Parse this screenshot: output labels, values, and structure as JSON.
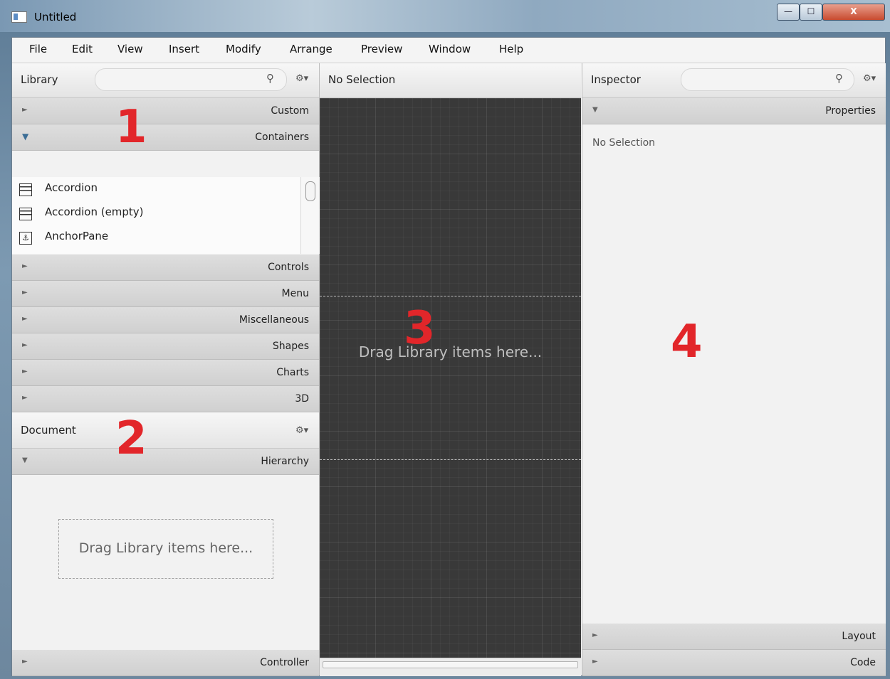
{
  "window": {
    "title": "Untitled",
    "minimize_glyph": "—",
    "maximize_glyph": "☐",
    "close_glyph": "X"
  },
  "menu": [
    "File",
    "Edit",
    "View",
    "Insert",
    "Modify",
    "Arrange",
    "Preview",
    "Window",
    "Help"
  ],
  "library": {
    "title": "Library",
    "search_icon": "⚲",
    "gear": "⚙▾",
    "sections": {
      "custom": "Custom",
      "containers": "Containers",
      "controls": "Controls",
      "menu": "Menu",
      "miscellaneous": "Miscellaneous",
      "shapes": "Shapes",
      "charts": "Charts",
      "three_d": "3D"
    },
    "items": [
      {
        "label": "Accordion",
        "icon": "accordion-icon"
      },
      {
        "label": "Accordion  (empty)",
        "icon": "accordion-icon"
      },
      {
        "label": "AnchorPane",
        "icon": "anchor-icon"
      }
    ],
    "anchor_glyph": "⚓"
  },
  "document": {
    "title": "Document",
    "gear": "⚙▾",
    "hierarchy": "Hierarchy",
    "drop_text": "Drag Library items here...",
    "controller": "Controller"
  },
  "canvas": {
    "header": "No Selection",
    "drop_text": "Drag Library items here..."
  },
  "inspector": {
    "title": "Inspector",
    "search_icon": "⚲",
    "gear": "⚙▾",
    "properties": "Properties",
    "no_selection": "No Selection",
    "layout": "Layout",
    "code": "Code"
  },
  "annotations": {
    "one": "1",
    "two": "2",
    "three": "3",
    "four": "4"
  },
  "arrows": {
    "collapsed": "►",
    "expanded": "▼"
  },
  "colors": {
    "annotation": "#e2262a",
    "canvas": "#3a3a3a",
    "panel": "#f2f2f2"
  }
}
